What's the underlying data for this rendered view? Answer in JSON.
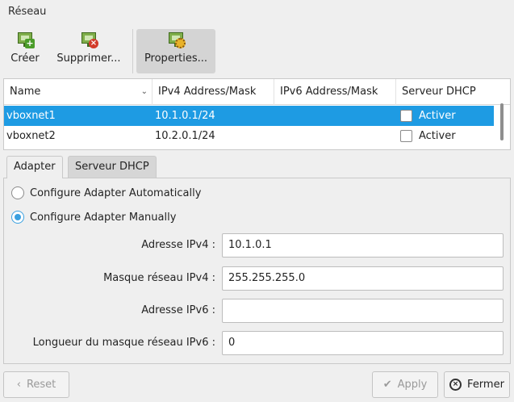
{
  "section_title": "Réseau",
  "toolbar": {
    "create_label": "Créer",
    "remove_label": "Supprimer...",
    "properties_label": "Properties..."
  },
  "table": {
    "columns": [
      "Name",
      "IPv4 Address/Mask",
      "IPv6 Address/Mask",
      "Serveur DHCP"
    ],
    "rows": [
      {
        "name": "vboxnet1",
        "ipv4": "10.1.0.1/24",
        "ipv6": "",
        "dhcp_label": "Activer",
        "dhcp_checked": false,
        "selected": true
      },
      {
        "name": "vboxnet2",
        "ipv4": "10.2.0.1/24",
        "ipv6": "",
        "dhcp_label": "Activer",
        "dhcp_checked": false,
        "selected": false
      }
    ]
  },
  "tabs": [
    {
      "label": "Adapter",
      "active": true
    },
    {
      "label": "Serveur DHCP",
      "active": false
    }
  ],
  "adapter": {
    "auto_label": "Configure Adapter Automatically",
    "manual_label": "Configure Adapter Manually",
    "selected_mode": "manual",
    "ipv4_address_label": "Adresse IPv4 :",
    "ipv4_address_value": "10.1.0.1",
    "ipv4_mask_label": "Masque réseau IPv4 :",
    "ipv4_mask_value": "255.255.255.0",
    "ipv6_address_label": "Adresse IPv6 :",
    "ipv6_address_value": "",
    "ipv6_prefix_label": "Longueur du masque réseau IPv6 :",
    "ipv6_prefix_value": "0"
  },
  "buttons": {
    "reset_label": "Reset",
    "apply_label": "Apply",
    "close_label": "Fermer"
  },
  "colors": {
    "selection": "#1e9be3",
    "accent": "#3aa0e0"
  }
}
